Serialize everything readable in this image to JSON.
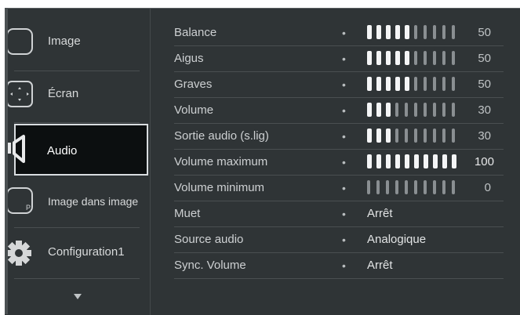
{
  "sidebar": {
    "items": [
      {
        "label": "Image",
        "icon": "image-icon"
      },
      {
        "label": "Écran",
        "icon": "screen-icon"
      },
      {
        "label": "Audio",
        "icon": "audio-icon",
        "active": true
      },
      {
        "label": "Image dans image",
        "icon": "pip-icon"
      },
      {
        "label": "Configuration1",
        "icon": "gear-icon"
      }
    ],
    "more_icon": "chevron-down-icon",
    "pip_letter": "P"
  },
  "rows": [
    {
      "label": "Balance",
      "type": "slider",
      "value": 50,
      "filled": 5,
      "display": "50"
    },
    {
      "label": "Aigus",
      "type": "slider",
      "value": 50,
      "filled": 5,
      "display": "50"
    },
    {
      "label": "Graves",
      "type": "slider",
      "value": 50,
      "filled": 5,
      "display": "50"
    },
    {
      "label": "Volume",
      "type": "slider",
      "value": 30,
      "filled": 3,
      "display": "30"
    },
    {
      "label": "Sortie audio (s.lig)",
      "type": "slider",
      "value": 30,
      "filled": 3,
      "display": "30"
    },
    {
      "label": "Volume maximum",
      "type": "slider",
      "value": 100,
      "filled": 10,
      "display": "100"
    },
    {
      "label": "Volume minimum",
      "type": "slider",
      "value": 0,
      "filled": 0,
      "display": "0"
    },
    {
      "label": "Muet",
      "type": "option",
      "display": "Arrêt"
    },
    {
      "label": "Source audio",
      "type": "option",
      "display": "Analogique"
    },
    {
      "label": "Sync. Volume",
      "type": "option",
      "display": "Arrêt"
    }
  ],
  "bullet": "•",
  "colors": {
    "background": "#2f3436",
    "selected_background": "#0c0f10",
    "selected_border": "#d9dde0",
    "bar_filled": "#f4f5f6",
    "bar_empty": "#8a8f92"
  }
}
